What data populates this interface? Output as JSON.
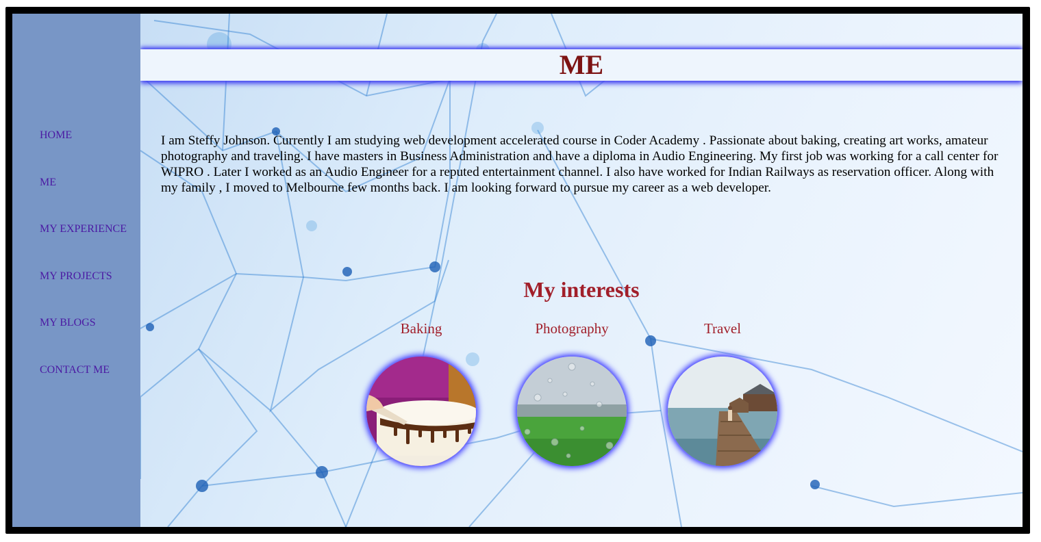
{
  "nav": {
    "items": [
      {
        "label": "HOME"
      },
      {
        "label": "ME"
      },
      {
        "label": "MY EXPERIENCE"
      },
      {
        "label": "MY PROJECTS"
      },
      {
        "label": "MY BLOGS"
      },
      {
        "label": "CONTACT ME"
      }
    ]
  },
  "header": {
    "title": "ME"
  },
  "about": {
    "text": "I am Steffy Johnson. Currently I am studying web development accelerated course in Coder Academy . Passionate about baking, creating art works, amateur photography and traveling. I have masters in Business Administration and have a diploma in Audio Engineering. My first job was working for a call center for WIPRO . Later I worked as an Audio Engineer for a reputed entertainment channel. I also have worked for Indian Railways as reservation officer. Along with my family , I moved to Melbourne few months back. I am looking forward to pursue my career as a web developer."
  },
  "interests": {
    "heading": "My interests",
    "items": [
      {
        "label": "Baking",
        "icon": "cake-photo"
      },
      {
        "label": "Photography",
        "icon": "rain-window-photo"
      },
      {
        "label": "Travel",
        "icon": "pier-photo"
      }
    ]
  },
  "colors": {
    "sidebar": "#7896c6",
    "nav_link": "#4b1aa3",
    "title": "#7d1313",
    "interest_text": "#a11f2a",
    "glow": "#3f3ff0"
  }
}
